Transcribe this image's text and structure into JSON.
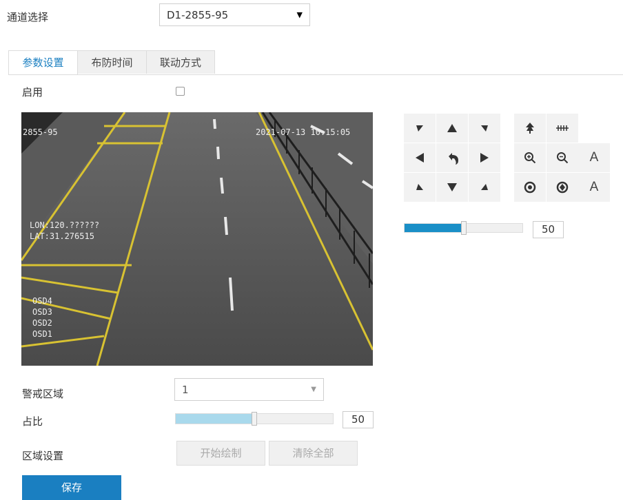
{
  "channel": {
    "label": "通道选择",
    "value": "D1-2855-95"
  },
  "tabs": [
    {
      "label": "参数设置"
    },
    {
      "label": "布防时间"
    },
    {
      "label": "联动方式"
    }
  ],
  "enable": {
    "label": "启用",
    "checked": false
  },
  "video": {
    "osd_id": "2855-95",
    "timestamp": "2021-07-13 10:15:05",
    "lon": "LON:120.??????",
    "lat": "LAT:31.276515",
    "osd_lines": [
      "OSD4",
      "OSD3",
      "OSD2",
      "OSD1"
    ]
  },
  "ptz": {
    "icons": [
      "up-left",
      "up",
      "up-right",
      "left",
      "return",
      "right",
      "down-left",
      "down",
      "down-right"
    ],
    "side_icons": [
      "tree-icon",
      "dots-icon",
      "zoom-in",
      "zoom-out",
      "text-A",
      "focus-in",
      "focus-out",
      "text-A"
    ],
    "text_a": "A",
    "speed": {
      "value": "50",
      "fraction": 0.5
    }
  },
  "alert_zone": {
    "label": "警戒区域",
    "value": "1"
  },
  "ratio": {
    "label": "占比",
    "value": "50",
    "fraction": 0.5
  },
  "zone_setting": {
    "label": "区域设置",
    "start_label": "开始绘制",
    "clear_label": "清除全部"
  },
  "save_label": "保存",
  "colors": {
    "accent": "#1a7fc1",
    "slider_fill": "#1a8fc7",
    "ratio_fill": "#a9d9ec"
  }
}
